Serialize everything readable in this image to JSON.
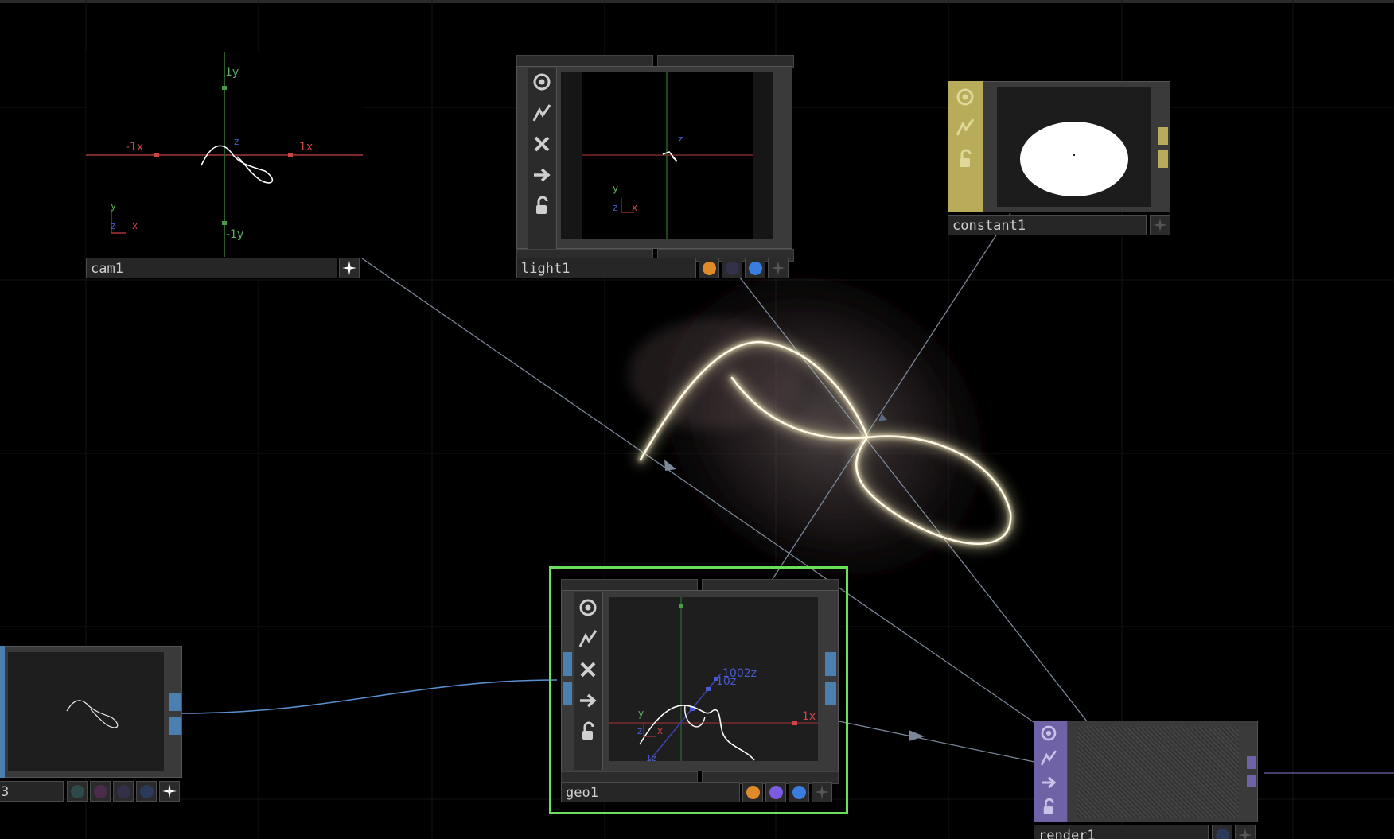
{
  "nodes": {
    "cam1": {
      "name": "cam1",
      "axis": {
        "pos_y": "1y",
        "neg_y": "-1y",
        "pos_x": "1x",
        "neg_x": "-1x",
        "z": "z"
      },
      "gizmo": {
        "y": "y",
        "x": "x",
        "z": "z"
      }
    },
    "light1": {
      "name": "light1",
      "axis": {
        "z": "z"
      },
      "gizmo": {
        "y": "y",
        "x": "x",
        "z": "z"
      }
    },
    "constant1": {
      "name": "constant1"
    },
    "geo1": {
      "name": "geo1",
      "axis": {
        "pos_x": "1x",
        "z_a": "1002z",
        "z_b": "10z",
        "neg_z": "1z"
      },
      "gizmo": {
        "y": "y",
        "x": "x",
        "z": "z"
      }
    },
    "left_node": {
      "name": "3"
    },
    "render1": {
      "name": "render1"
    }
  },
  "colors": {
    "selected_outline": "#6ae05a",
    "constant_accent": "#b8ac5a",
    "render_accent": "#6f62a6",
    "wire": "#8391a3",
    "blue_wire": "#5a8fd0",
    "orange_flag": "#e08b2a",
    "blue_flag": "#3a7de0",
    "purple_flag": "#7b5ce0"
  }
}
